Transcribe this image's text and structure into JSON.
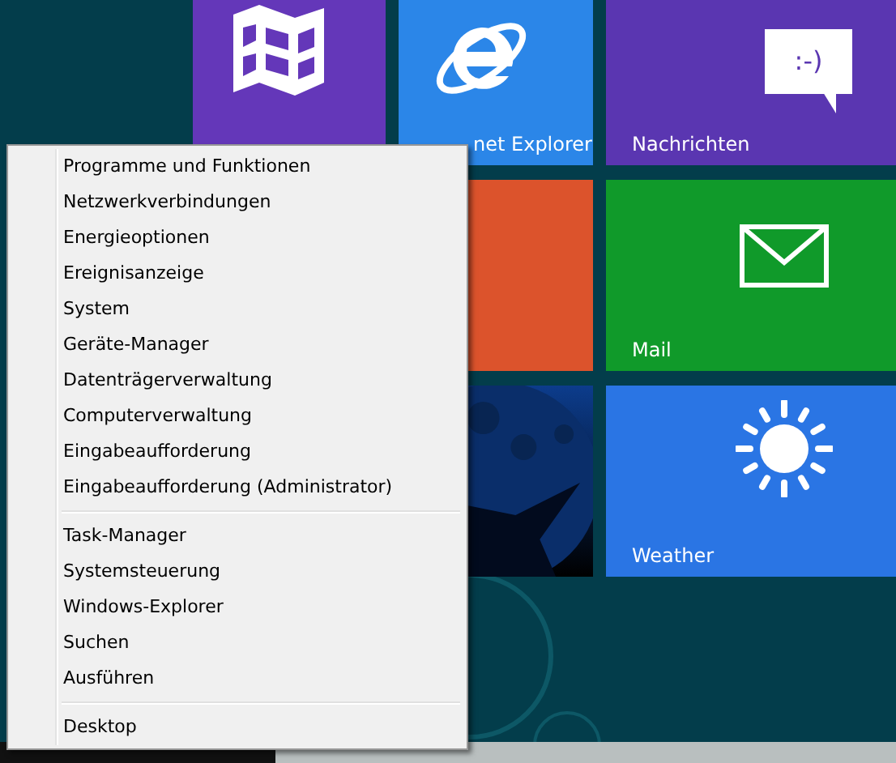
{
  "tiles": [
    {
      "kind": "maps",
      "color": "#6437b9"
    },
    {
      "kind": "browser",
      "color": "#2b86e8",
      "label": "net Explorer"
    },
    {
      "kind": "messaging",
      "color": "#5a36b1",
      "label": "Nachrichten",
      "icon_text": ":-)"
    },
    {
      "kind": "plain",
      "color": "#dc532c"
    },
    {
      "kind": "mail",
      "color": "#109a2a",
      "label": "Mail"
    },
    {
      "kind": "picture"
    },
    {
      "kind": "weather",
      "color": "#2a75e4",
      "label": "Weather"
    }
  ],
  "context_menu": {
    "groups": [
      [
        "Programme und Funktionen",
        "Netzwerkverbindungen",
        "Energieoptionen",
        "Ereignisanzeige",
        "System",
        "Geräte-Manager",
        "Datenträgerverwaltung",
        "Computerverwaltung",
        "Eingabeaufforderung",
        "Eingabeaufforderung (Administrator)"
      ],
      [
        "Task-Manager",
        "Systemsteuerung",
        "Windows-Explorer",
        "Suchen",
        "Ausführen"
      ],
      [
        "Desktop"
      ]
    ]
  }
}
